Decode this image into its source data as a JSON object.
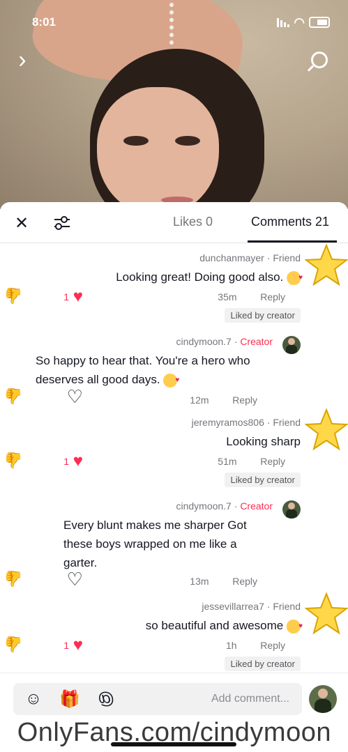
{
  "status_bar": {
    "time": "8:01"
  },
  "panel": {
    "tabs": [
      {
        "label": "Comments 21"
      },
      {
        "label": "Likes 0"
      }
    ]
  },
  "comments": [
    {
      "username": "dunchanmayer",
      "tag": "Friend",
      "text": "Looking great! Doing good also.",
      "time": "35m",
      "reply": "Reply",
      "likes": "1",
      "liked_by_creator": "Liked by creator"
    },
    {
      "username": "cindymoon.7",
      "tag": "Creator",
      "text": "So happy to hear that. You're a hero who deserves all good days.",
      "time": "12m",
      "reply": "Reply"
    },
    {
      "username": "jeremyramos806",
      "tag": "Friend",
      "text": "Looking sharp",
      "time": "51m",
      "reply": "Reply",
      "likes": "1",
      "liked_by_creator": "Liked by creator"
    },
    {
      "username": "cindymoon.7",
      "tag": "Creator",
      "text": "Every blunt makes me sharper Got these boys wrapped on me like a garter.",
      "time": "13m",
      "reply": "Reply"
    },
    {
      "username": "jessevillarrea7",
      "tag": "Friend",
      "text": "so beautiful and awesome",
      "time": "1h",
      "reply": "Reply",
      "likes": "1",
      "liked_by_creator": "Liked by creator"
    }
  ],
  "input": {
    "placeholder": "Add comment..."
  },
  "watermark": "OnlyFans.com/cindymoon",
  "icons": {
    "search": "search-icon",
    "next": "chevron-right-icon",
    "close": "close-icon",
    "filter": "sliders-icon",
    "like": "heart-icon",
    "dislike": "thumbs-down-icon",
    "emoji": "smiley-icon",
    "gift": "gift-icon",
    "mention": "at-icon"
  },
  "colors": {
    "accent": "#fe2c55",
    "text": "#161823",
    "muted": "#75767c"
  }
}
